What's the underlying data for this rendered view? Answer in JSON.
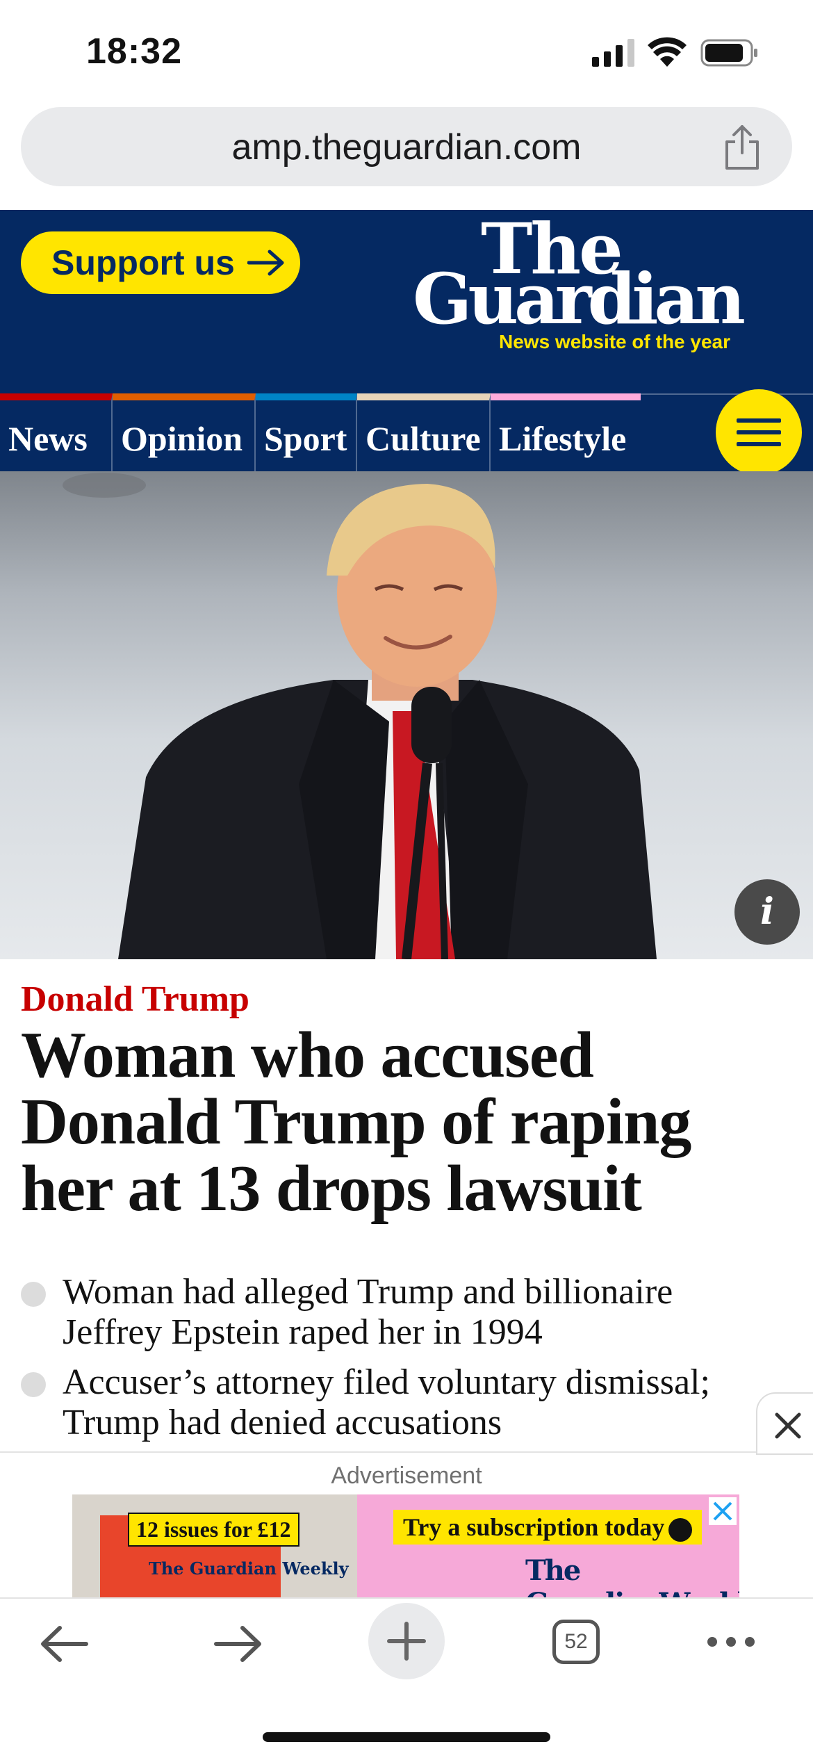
{
  "status_bar": {
    "time": "18:32"
  },
  "browser": {
    "url": "amp.theguardian.com",
    "tab_count": "52"
  },
  "header": {
    "support_label": "Support us",
    "logo_the": "The",
    "logo_guardian": "Guardian",
    "tagline": "News website of the year"
  },
  "nav": {
    "items": [
      {
        "label": "News",
        "color": "#c70000"
      },
      {
        "label": "Opinion",
        "color": "#e05e00"
      },
      {
        "label": "Sport",
        "color": "#0084c6"
      },
      {
        "label": "Culture",
        "color": "#a1845c"
      },
      {
        "label": "Lifestyle",
        "color": "#bb3b80"
      }
    ]
  },
  "article": {
    "kicker": "Donald Trump",
    "headline": "Woman who accused Donald Trump of raping her at 13 drops lawsuit",
    "bullets": [
      "Woman had alleged Trump and billionaire Jeffrey Epstein raped her in 1994",
      "Accuser’s attorney filed voluntary dismissal; Trump had denied accusations"
    ],
    "image_info_icon": "info-icon"
  },
  "ad": {
    "label": "Advertisement",
    "issues": "12 issues for £12",
    "mini_logo": "The Guardian Weekly",
    "cta": "Try a subscription today",
    "brand": "The GuardianWeekly"
  },
  "colors": {
    "guardian_blue": "#052962",
    "yellow": "#ffe500",
    "kicker_red": "#c70000"
  }
}
